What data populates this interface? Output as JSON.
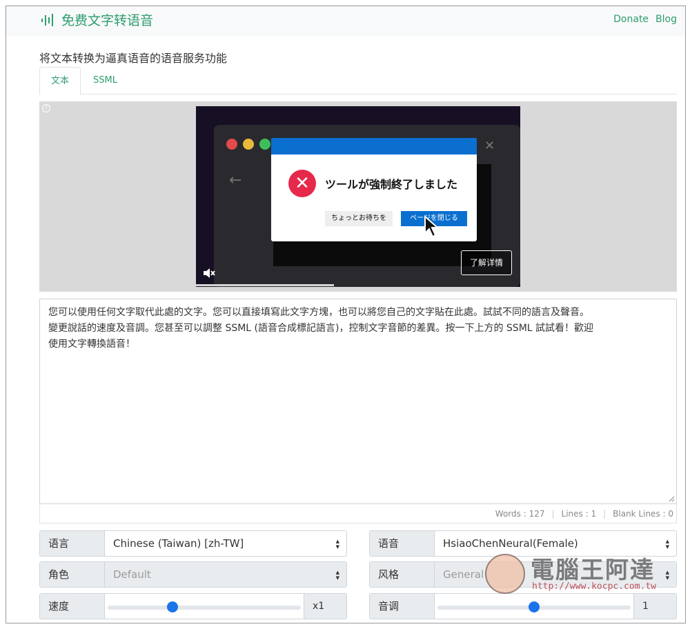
{
  "navbar": {
    "brand": "免费文字转语音",
    "links": [
      "Donate",
      "Blog"
    ]
  },
  "subtitle": "将文本转换为逼真语音的语音服务功能",
  "tabs": [
    "文本",
    "SSML"
  ],
  "ad": {
    "dialog_message": "ツールが強制終了しました",
    "wait_button": "ちょっとお待ちを",
    "close_button": "ページを閉じる",
    "learn_more": "了解详情"
  },
  "textarea": {
    "lines": [
      "您可以使用任何文字取代此處的文字。您可以直接填寫此文字方塊，也可以將您自己的文字貼在此處。試試不同的語言及聲音。",
      "變更說話的速度及音調。您甚至可以調整 SSML (語音合成標記語言)，控制文字音節的差異。按一下上方的 SSML 試試看！歡迎",
      "使用文字轉換語音！"
    ]
  },
  "stats": {
    "words": "Words : 127",
    "lines": "Lines : 1",
    "blank": "Blank Lines : 0"
  },
  "controls": {
    "language": {
      "label": "语言",
      "value": "Chinese (Taiwan) [zh-TW]"
    },
    "voice": {
      "label": "语音",
      "value": "HsiaoChenNeural(Female)"
    },
    "role": {
      "label": "角色",
      "value": "Default"
    },
    "style": {
      "label": "风格",
      "value": "General"
    },
    "speed": {
      "label": "速度",
      "value": "x1",
      "level": 0.33
    },
    "pitch": {
      "label": "音调",
      "value": "1",
      "level": 0.5
    }
  },
  "watermark": {
    "title": "電腦王阿達",
    "url": "http://www.kocpc.com.tw"
  },
  "colors": {
    "brand": "#2d9d6d",
    "slider": "#1a73e8",
    "dialog_header": "#0b6fcf",
    "error": "#e6284b"
  }
}
